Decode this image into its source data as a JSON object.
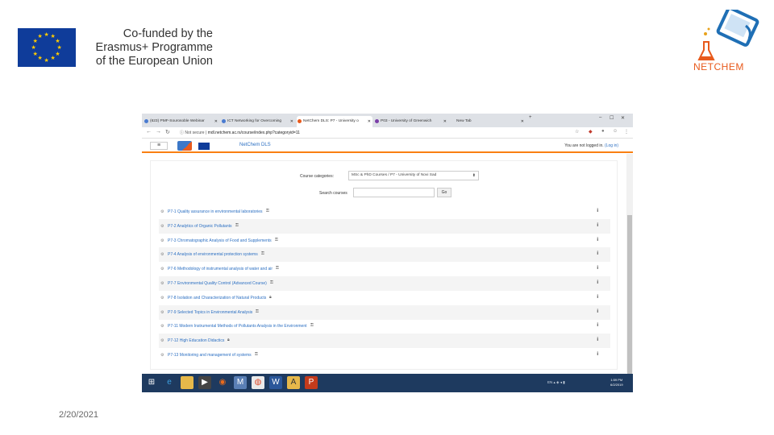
{
  "slide": {
    "cofund_lines": [
      "Co-funded by the",
      "Erasmus+ Programme",
      "of the European Union"
    ],
    "brand_name": "NETCHEM",
    "date": "2/20/2021"
  },
  "browser": {
    "tabs": [
      {
        "label": "(623) PMF-Sourosoble Webinar",
        "active": false
      },
      {
        "label": "ICT Networking for Overcoming",
        "active": false
      },
      {
        "label": "NetChem DLS: P7 - University o",
        "active": true
      },
      {
        "label": "P03 - University of Greenwich",
        "active": false
      },
      {
        "label": "New Tab",
        "active": false
      }
    ],
    "url_security": "Not secure",
    "url": "mdl.netchem.ac.rs/course/index.php?categoryid=11"
  },
  "site": {
    "name": "NetChem DLS",
    "login_prefix": "You are not logged in.",
    "login_link": "(Log in)",
    "category_label": "Course categories:",
    "category_value": "MSc & PhD Courses / P7 - University of Novi Sad",
    "search_label": "Search courses",
    "search_value": "",
    "go_label": "Go",
    "courses": [
      {
        "name": "P7-1 Quality assurance in environmental laboratories",
        "icon": "key-icon"
      },
      {
        "name": "P7-2 Analytics of Organic Pollutants",
        "icon": "key-icon"
      },
      {
        "name": "P7-3 Chromatographic Analysis of Food and Supplements",
        "icon": "key-icon"
      },
      {
        "name": "P7-4 Analysis of environmental protection systems",
        "icon": "key-icon"
      },
      {
        "name": "P7-6 Methodology of instrumental analysis of water and air",
        "icon": "key-icon"
      },
      {
        "name": "P7-7 Environmental Quality Control (Advanced Course)",
        "icon": "key-icon"
      },
      {
        "name": "P7-8 Isolation and Characterization of Natural Products",
        "icon": "lock-icon"
      },
      {
        "name": "P7-9 Selected Topics in Environmental Analysis",
        "icon": "key-icon"
      },
      {
        "name": "P7-11 Modern Instrumental Methods of Pollutants Analysis in the Environment",
        "icon": "key-icon"
      },
      {
        "name": "P7-12 High Education Didactics",
        "icon": "lock-icon"
      },
      {
        "name": "P7-13 Monitoring and management of systems",
        "icon": "key-icon"
      }
    ]
  },
  "taskbar": {
    "lang": "EN",
    "time": "1:59 PM",
    "date": "6/2/2019"
  },
  "colors": {
    "moodle_orange": "#f98012",
    "link_blue": "#2b6fc2",
    "eu_blue": "#0f3c9a",
    "eu_gold": "#ffcc00",
    "netchem_orange": "#e85a1c",
    "netchem_blue": "#1f6fb5"
  }
}
